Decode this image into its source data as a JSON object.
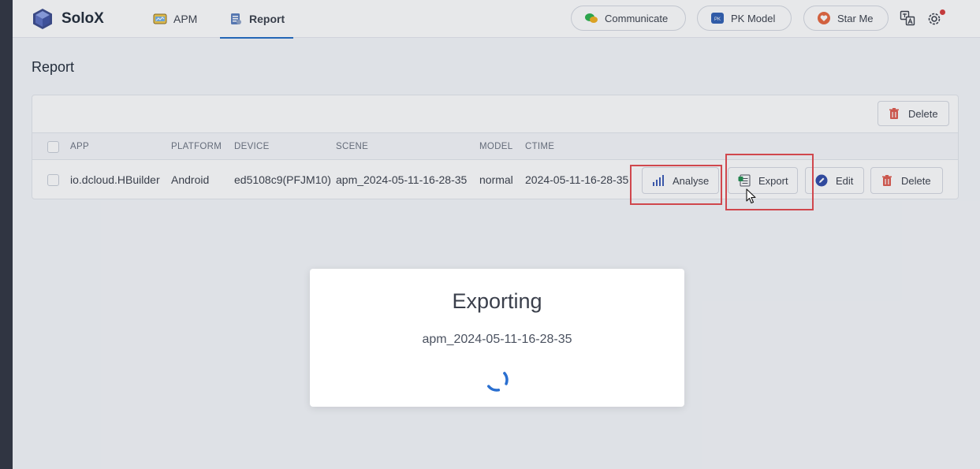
{
  "app": {
    "name": "SoloX"
  },
  "nav": {
    "tabs": [
      {
        "label": "APM",
        "icon": "gauge-icon"
      },
      {
        "label": "Report",
        "icon": "clipboard-icon",
        "active": true
      }
    ]
  },
  "header_actions": {
    "communicate": "Communicate",
    "pk_model": "PK Model",
    "star_me": "Star Me"
  },
  "page": {
    "title": "Report"
  },
  "toolbar": {
    "delete_label": "Delete"
  },
  "table": {
    "columns": [
      "APP",
      "PLATFORM",
      "DEVICE",
      "SCENE",
      "MODEL",
      "CTIME"
    ],
    "rows": [
      {
        "app": "io.dcloud.HBuilder",
        "platform": "Android",
        "device": "ed5108c9(PFJM10)",
        "scene": "apm_2024-05-11-16-28-35",
        "model": "normal",
        "ctime": "2024-05-11-16-28-35",
        "actions": {
          "analyse": "Analyse",
          "export": "Export",
          "edit": "Edit",
          "delete": "Delete"
        }
      }
    ]
  },
  "modal": {
    "title": "Exporting",
    "subtitle": "apm_2024-05-11-16-28-35"
  },
  "colors": {
    "accent": "#206bc4",
    "highlight": "#e5484d",
    "danger": "#d63939"
  }
}
